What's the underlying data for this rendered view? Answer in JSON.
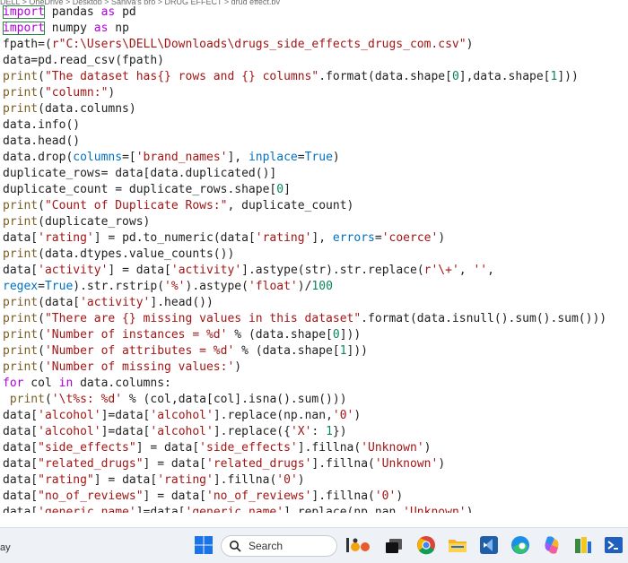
{
  "breadcrumb": "DELL > OneDrive > Desktop > Sanjya's pro > DRUG EFFECT > drug effect.py",
  "code_lines": [
    "import pandas as pd",
    "import numpy as np",
    "fpath=(r\"C:\\Users\\DELL\\Downloads\\drugs_side_effects_drugs_com.csv\")",
    "data=pd.read_csv(fpath)",
    "print(\"The dataset has{} rows and {} columns\".format(data.shape[0],data.shape[1]))",
    "print(\"column:\")",
    "print(data.columns)",
    "data.info()",
    "data.head()",
    "data.drop(columns=['brand_names'], inplace=True)",
    "duplicate_rows= data[data.duplicated()]",
    "duplicate_count = duplicate_rows.shape[0]",
    "print(\"Count of Duplicate Rows:\", duplicate_count)",
    "print(duplicate_rows)",
    "data['rating'] = pd.to_numeric(data['rating'], errors='coerce')",
    "print(data.dtypes.value_counts())",
    "data['activity'] = data['activity'].astype(str).str.replace(r'\\+', '',",
    "regex=True).str.rstrip('%').astype('float')/100",
    "print(data['activity'].head())",
    "print(\"There are {} missing values in this dataset\".format(data.isnull().sum().sum()))",
    "print('Number of instances = %d' % (data.shape[0]))",
    "print('Number of attributes = %d' % (data.shape[1]))",
    "print('Number of missing values:')",
    "for col in data.columns:",
    " print('\\t%s: %d' % (col,data[col].isna().sum()))",
    "data['alcohol']=data['alcohol'].replace(np.nan,'0')",
    "data['alcohol']=data['alcohol'].replace({'X': 1})",
    "data[\"side_effects\"] = data['side_effects'].fillna('Unknown')",
    "data[\"related_drugs\"] = data['related_drugs'].fillna('Unknown')",
    "data[\"rating\"] = data['rating'].fillna('0')",
    "data[\"no_of_reviews\"] = data['no_of_reviews'].fillna('0')",
    "data['generic_name']=data['generic_name'].replace(np.nan,'Unknown')"
  ],
  "taskbar": {
    "left_text": "ay",
    "search_label": "Search",
    "icons": [
      "windows-start-icon",
      "search-icon",
      "widgets-icon",
      "task-view-icon",
      "chrome-icon",
      "file-explorer-icon",
      "vscode-icon",
      "edge-icon",
      "copilot-icon",
      "office-icon",
      "terminal-icon"
    ]
  }
}
